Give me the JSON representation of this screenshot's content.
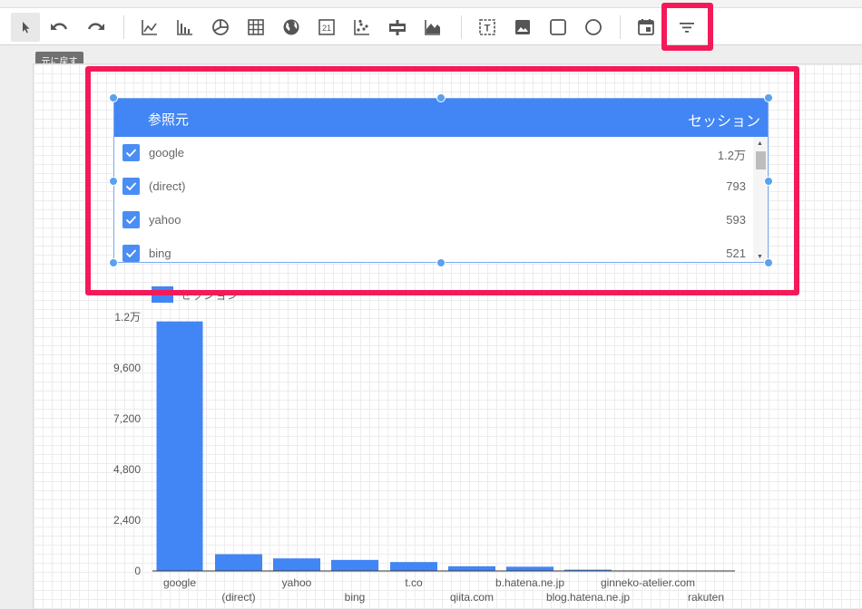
{
  "toolbar": {
    "tooltip": "元に戻す",
    "tools": [
      {
        "name": "select-tool",
        "icon": "cursor-icon"
      },
      {
        "name": "undo-button",
        "icon": "undo-icon"
      },
      {
        "name": "redo-button",
        "icon": "redo-icon"
      },
      {
        "name": "time-series-tool",
        "icon": "line-chart-icon"
      },
      {
        "name": "bar-chart-tool",
        "icon": "bar-chart-icon"
      },
      {
        "name": "pie-chart-tool",
        "icon": "pie-chart-icon"
      },
      {
        "name": "table-tool",
        "icon": "table-icon"
      },
      {
        "name": "geo-map-tool",
        "icon": "globe-icon"
      },
      {
        "name": "scorecard-tool",
        "icon": "scorecard-icon",
        "label": "21"
      },
      {
        "name": "scatter-chart-tool",
        "icon": "scatter-icon"
      },
      {
        "name": "bullet-chart-tool",
        "icon": "bullet-chart-icon"
      },
      {
        "name": "area-chart-tool",
        "icon": "area-chart-icon"
      },
      {
        "name": "text-tool",
        "icon": "text-box-icon",
        "label": "T"
      },
      {
        "name": "image-tool",
        "icon": "image-icon"
      },
      {
        "name": "rectangle-tool",
        "icon": "rectangle-icon"
      },
      {
        "name": "circle-tool",
        "icon": "circle-icon"
      },
      {
        "name": "date-range-tool",
        "icon": "calendar-icon"
      },
      {
        "name": "filter-control-tool",
        "icon": "filter-icon"
      }
    ]
  },
  "filter_control": {
    "dimension_header": "参照元",
    "metric_header": "セッション",
    "rows": [
      {
        "label": "google",
        "value": "1.2万",
        "checked": true
      },
      {
        "label": "(direct)",
        "value": "793",
        "checked": true
      },
      {
        "label": "yahoo",
        "value": "593",
        "checked": true
      },
      {
        "label": "bing",
        "value": "521",
        "checked": true
      }
    ]
  },
  "colors": {
    "accent": "#4285f4",
    "highlight": "#f41a5a"
  },
  "chart_data": {
    "type": "bar",
    "legend": "セッション",
    "categories": [
      "google",
      "(direct)",
      "yahoo",
      "bing",
      "t.co",
      "qiita.com",
      "b.hatena.ne.jp",
      "blog.hatena.ne.jp",
      "ginneko-atelier.com",
      "rakuten"
    ],
    "values": [
      11800,
      793,
      593,
      521,
      420,
      220,
      200,
      60,
      20,
      12
    ],
    "ylim": [
      0,
      12000
    ],
    "yticks": [
      {
        "v": 0,
        "label": "0"
      },
      {
        "v": 2400,
        "label": "2,400"
      },
      {
        "v": 4800,
        "label": "4,800"
      },
      {
        "v": 7200,
        "label": "7,200"
      },
      {
        "v": 9600,
        "label": "9,600"
      },
      {
        "v": 12000,
        "label": "1.2万"
      }
    ],
    "grid": false
  }
}
